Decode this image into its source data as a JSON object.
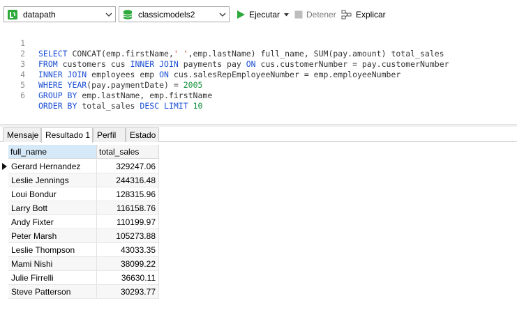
{
  "toolbar": {
    "connection": "datapath",
    "database": "classicmodels2",
    "run_label": "Ejecutar",
    "stop_label": "Detener",
    "explain_label": "Explicar"
  },
  "editor": {
    "line_numbers": [
      "1",
      "2",
      "3",
      "4",
      "5",
      "6"
    ]
  },
  "tabs": [
    {
      "label": "Mensaje"
    },
    {
      "label": "Resultado 1"
    },
    {
      "label": "Perfil"
    },
    {
      "label": "Estado"
    }
  ],
  "grid": {
    "columns": [
      "full_name",
      "total_sales"
    ],
    "rows": [
      {
        "full_name": "Gerard Hernandez",
        "total_sales": "329247.06"
      },
      {
        "full_name": "Leslie Jennings",
        "total_sales": "244316.48"
      },
      {
        "full_name": "Loui Bondur",
        "total_sales": "128315.96"
      },
      {
        "full_name": "Larry Bott",
        "total_sales": "116158.76"
      },
      {
        "full_name": "Andy Fixter",
        "total_sales": "110199.97"
      },
      {
        "full_name": "Peter Marsh",
        "total_sales": "105273.88"
      },
      {
        "full_name": "Leslie Thompson",
        "total_sales": "43033.35"
      },
      {
        "full_name": "Mami Nishi",
        "total_sales": "38099.22"
      },
      {
        "full_name": "Julie Firrelli",
        "total_sales": "36630.11"
      },
      {
        "full_name": "Steve Patterson",
        "total_sales": "30293.77"
      }
    ]
  },
  "colors": {
    "keyword": "#1b4fd3",
    "number": "#0f8f3a",
    "string": "#c0392b",
    "run_green": "#2eaa3c"
  },
  "icons": {
    "connection": "database-connection-icon",
    "database": "database-icon",
    "run": "play-icon",
    "stop": "stop-icon",
    "explain": "explain-plan-icon",
    "current_row": "row-pointer-icon"
  }
}
